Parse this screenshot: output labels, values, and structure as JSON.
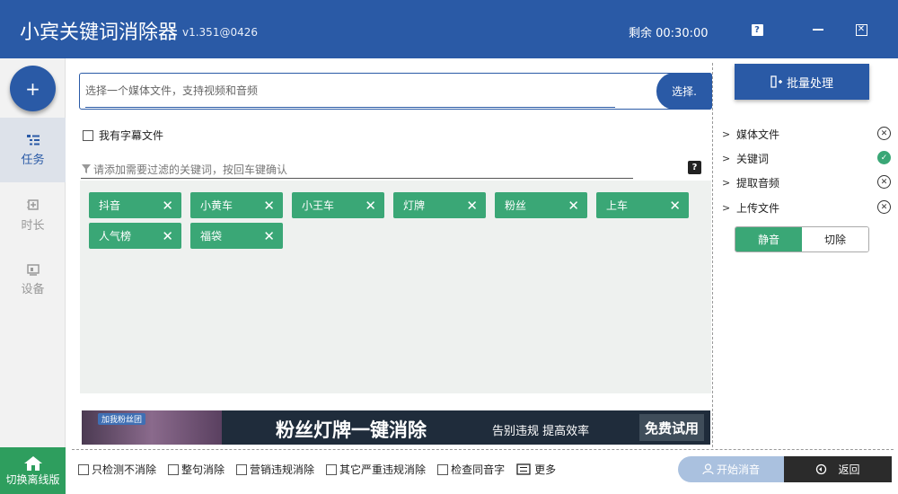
{
  "app": {
    "title": "小宾关键词消除器",
    "version": "v1.351@0426",
    "remaining": "剩余 00:30:00"
  },
  "sidebar": {
    "add_label": "+",
    "items": [
      {
        "label": "任务",
        "icon": "task-list-icon",
        "active": true
      },
      {
        "label": "时长",
        "icon": "duration-icon",
        "active": false
      },
      {
        "label": "设备",
        "icon": "device-icon",
        "active": false
      }
    ],
    "offline_label": "切换离线版"
  },
  "file": {
    "placeholder": "选择一个媒体文件，支持视频和音频",
    "select_label": "选择."
  },
  "subtitle_option": "我有字幕文件",
  "keyword_input_placeholder": "请添加需要过滤的关键词，按回车键确认",
  "keyword_help": "?",
  "tags": [
    "抖音",
    "小黄车",
    "小王车",
    "灯牌",
    "粉丝",
    "上车",
    "人气榜",
    "福袋"
  ],
  "banner": {
    "badge": "加我粉丝团",
    "title": "粉丝灯牌一键消除",
    "subtitle": "告别违规 提高效率",
    "trial": "免费试用"
  },
  "right": {
    "batch_label": "批量处理",
    "steps": [
      {
        "label": "媒体文件",
        "status": "pending"
      },
      {
        "label": "关键词",
        "status": "done"
      },
      {
        "label": "提取音频",
        "status": "pending"
      },
      {
        "label": "上传文件",
        "status": "pending"
      }
    ],
    "mode_mute": "静音",
    "mode_cut": "切除"
  },
  "options": [
    "只检测不消除",
    "整句消除",
    "营销违规消除",
    "其它严重违规消除",
    "检查同音字"
  ],
  "more_label": "更多",
  "start_label": "开始消音",
  "back_label": "返回",
  "colors": {
    "primary": "#2a5aa6",
    "tag": "#3aa776",
    "offline": "#2e9e5e"
  }
}
